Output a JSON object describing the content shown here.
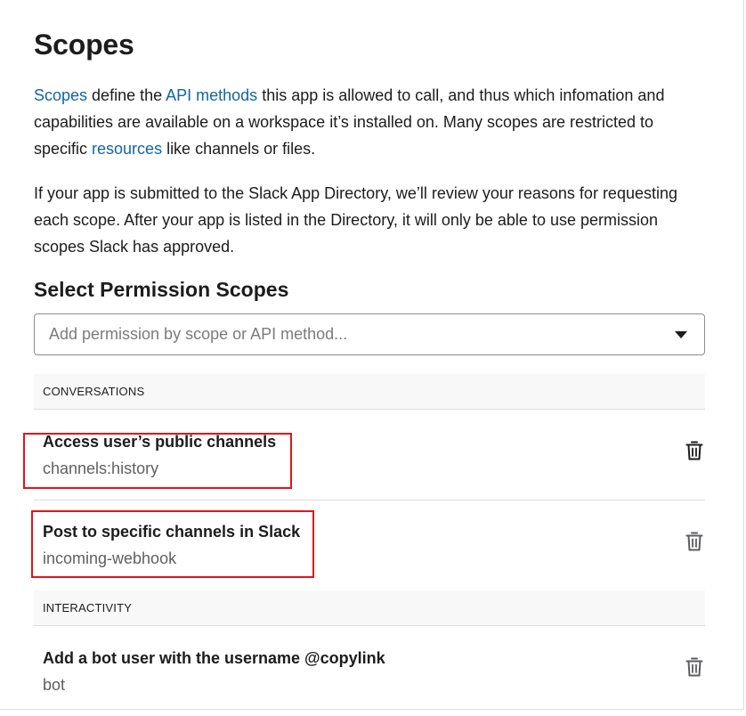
{
  "page": {
    "title": "Scopes",
    "intro": {
      "scopes_link": "Scopes",
      "text1": " define the ",
      "api_methods_link": "API methods",
      "text2": " this app is allowed to call, and thus which infomation and capabilities are available on a workspace it’s installed on. Many scopes are restricted to specific ",
      "resources_link": "resources",
      "text3": " like channels or files."
    },
    "review_note": "If your app is submitted to the Slack App Directory, we’ll review your reasons for requesting each scope. After your app is listed in the Directory, it will only be able to use permission scopes Slack has approved."
  },
  "permissions": {
    "heading": "Select Permission Scopes",
    "select_placeholder": "Add permission by scope or API method...",
    "sections": [
      {
        "label": "CONVERSATIONS",
        "scopes": [
          {
            "title": "Access user’s public channels",
            "name": "channels:history",
            "highlighted": true
          },
          {
            "title": "Post to specific channels in Slack",
            "name": "incoming-webhook",
            "highlighted": true
          }
        ]
      },
      {
        "label": "INTERACTIVITY",
        "scopes": [
          {
            "title": "Add a bot user with the username @copylink",
            "name": "bot",
            "highlighted": false
          }
        ]
      }
    ]
  },
  "icons": {
    "dropdown": "chevron-down-icon",
    "delete": "trash-icon"
  },
  "colors": {
    "link": "#1264a3",
    "highlight_box": "#e0141e",
    "section_bg": "#f8f8f8"
  }
}
